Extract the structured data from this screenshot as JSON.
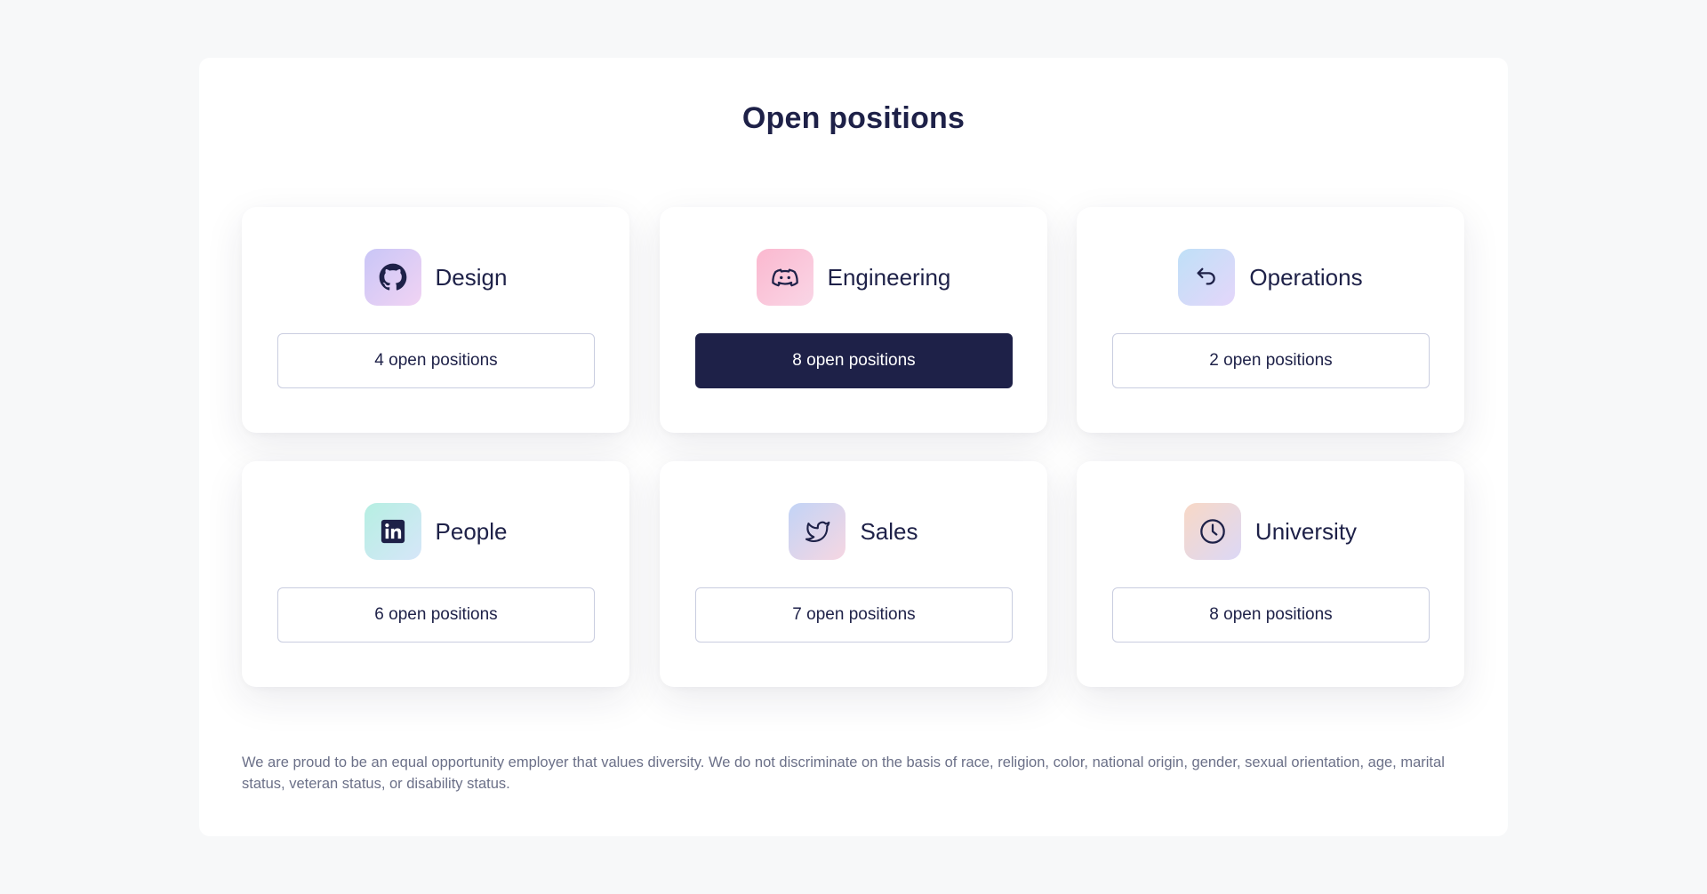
{
  "page": {
    "title": "Open positions",
    "footer": "We are proud to be an equal opportunity employer that values diversity. We do not discriminate on the basis of race, religion, color, national origin, gender, sexual orientation, age, marital status, veteran status, or disability status."
  },
  "departments": [
    {
      "label": "Design",
      "icon": "github-icon",
      "button": "4 open positions",
      "active": false
    },
    {
      "label": "Engineering",
      "icon": "discord-icon",
      "button": "8 open positions",
      "active": true
    },
    {
      "label": "Operations",
      "icon": "undo-arrow-icon",
      "button": "2 open positions",
      "active": false
    },
    {
      "label": "People",
      "icon": "linkedin-icon",
      "button": "6 open positions",
      "active": false
    },
    {
      "label": "Sales",
      "icon": "twitter-icon",
      "button": "7 open positions",
      "active": false
    },
    {
      "label": "University",
      "icon": "clock-icon",
      "button": "8 open positions",
      "active": false
    }
  ],
  "colors": {
    "navy": "#1e2148",
    "page_bg": "#f7f8f9",
    "muted_text": "#6b7088",
    "button_border": "#c9cde0"
  }
}
